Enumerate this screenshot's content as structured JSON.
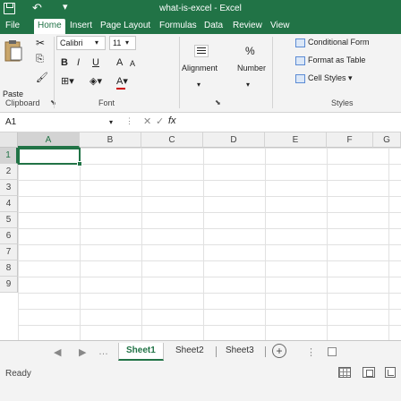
{
  "title": "what-is-excel - Excel",
  "tabs": [
    "File",
    "Home",
    "Insert",
    "Page Layout",
    "Formulas",
    "Data",
    "Review",
    "View"
  ],
  "ribbon": {
    "clipboard": {
      "paste_label": "Paste",
      "group_label": "Clipboard"
    },
    "font": {
      "family": "Calibri",
      "size": "11",
      "bold": "B",
      "italic": "I",
      "underline": "U",
      "grow": "A",
      "shrink": "A",
      "group_label": "Font"
    },
    "alignment": {
      "label": "Alignment"
    },
    "number": {
      "label": "Number",
      "symbol": "%"
    },
    "styles": {
      "conditional": "Conditional Form",
      "format_table": "Format as Table",
      "cell_styles": "Cell Styles",
      "group_label": "Styles"
    }
  },
  "formula_bar": {
    "name_box": "A1",
    "fx": "fx",
    "value": ""
  },
  "grid": {
    "columns": [
      "A",
      "B",
      "C",
      "D",
      "E",
      "F",
      "G"
    ],
    "rows": [
      "1",
      "2",
      "3",
      "4",
      "5",
      "6",
      "7",
      "8",
      "9"
    ],
    "selected_cell": "A1"
  },
  "sheets": [
    "Sheet1",
    "Sheet2",
    "Sheet3"
  ],
  "active_sheet": "Sheet1",
  "status": {
    "text": "Ready"
  },
  "colors": {
    "accent": "#217346"
  }
}
